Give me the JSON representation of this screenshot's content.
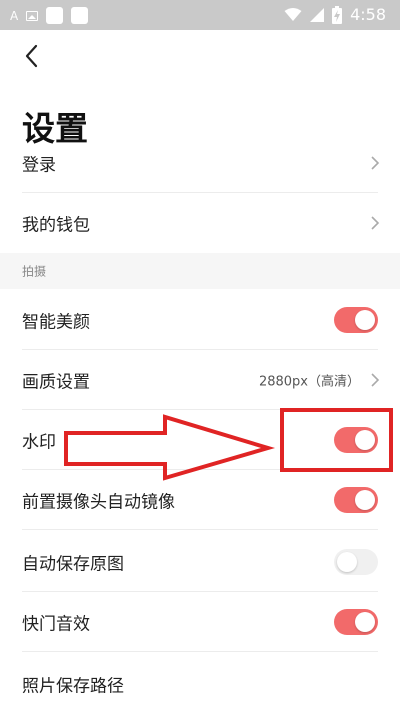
{
  "status_bar": {
    "left_glyph": "A",
    "time": "4:58",
    "icons": [
      "font-icon",
      "image-icon",
      "notification-square-icon",
      "notification-square-icon",
      "wifi-icon",
      "signal-icon",
      "battery-charging-icon"
    ]
  },
  "page": {
    "title": "设置"
  },
  "account_rows": [
    {
      "label": "登录",
      "has_chevron": true
    },
    {
      "label": "我的钱包",
      "has_chevron": true
    }
  ],
  "section": {
    "label": "拍摄"
  },
  "settings": [
    {
      "label": "智能美颜",
      "type": "toggle",
      "on": true
    },
    {
      "label": "画质设置",
      "type": "value",
      "value": "2880px（高清）"
    },
    {
      "label": "水印",
      "type": "toggle",
      "on": true
    },
    {
      "label": "前置摄像头自动镜像",
      "type": "toggle",
      "on": true
    },
    {
      "label": "自动保存原图",
      "type": "toggle",
      "on": false
    },
    {
      "label": "快门音效",
      "type": "toggle",
      "on": true
    },
    {
      "label": "照片保存路径",
      "type": "link"
    }
  ],
  "colors": {
    "toggle_on": "#f26a6a",
    "toggle_off": "#f0f0f0",
    "annotation": "#e02424"
  }
}
